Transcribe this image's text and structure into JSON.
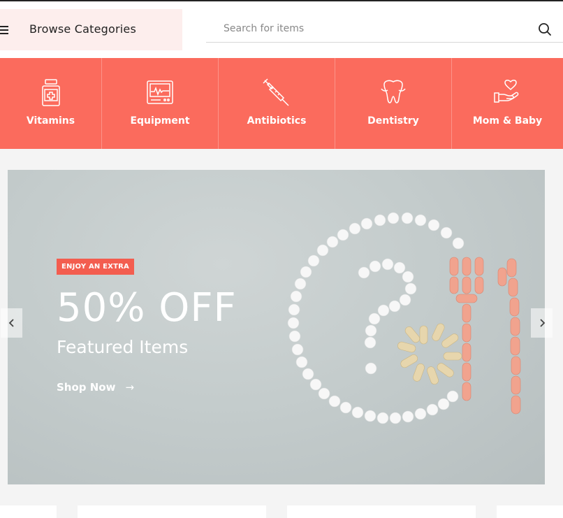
{
  "header": {
    "browse_label": "Browse Categories",
    "search_placeholder": "Search for items"
  },
  "categories": [
    {
      "label": "Vitamins",
      "icon": "vitamin-bottle-icon"
    },
    {
      "label": "Equipment",
      "icon": "monitor-icon"
    },
    {
      "label": "Antibiotics",
      "icon": "syringe-icon"
    },
    {
      "label": "Dentistry",
      "icon": "tooth-icon"
    },
    {
      "label": "Mom & Baby",
      "icon": "hand-heart-icon"
    }
  ],
  "hero": {
    "badge": "ENJOY AN EXTRA",
    "headline": "50% OFF",
    "subheadline": "Featured Items",
    "cta": "Shop Now",
    "cta_icon": "arrow-right-icon"
  },
  "colors": {
    "accent": "#fb6b5d",
    "badge": "#f35d4f",
    "browse_bg": "#fdeeed"
  }
}
